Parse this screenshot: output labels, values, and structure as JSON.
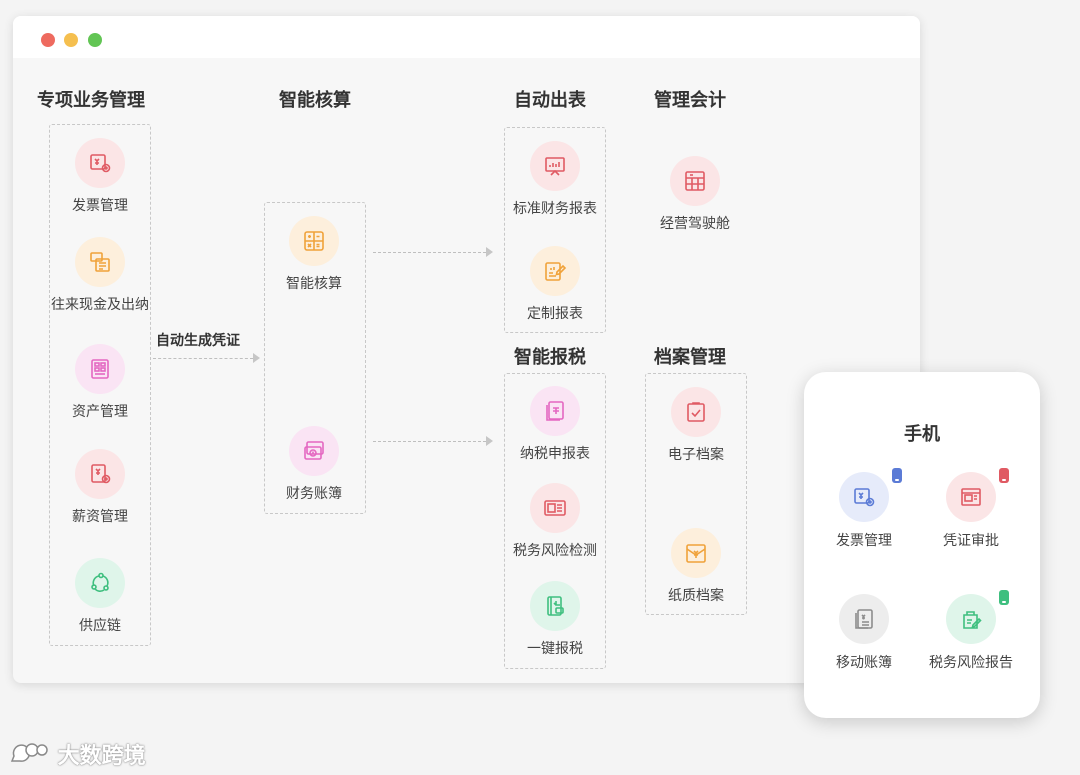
{
  "window": {
    "columns": {
      "special_business": {
        "title": "专项业务管理",
        "items": [
          {
            "label": "发票管理",
            "icon": "invoice-gear-icon"
          },
          {
            "label": "往来现金及出纳",
            "icon": "cash-document-icon"
          },
          {
            "label": "资产管理",
            "icon": "asset-list-icon"
          },
          {
            "label": "薪资管理",
            "icon": "salary-document-icon"
          },
          {
            "label": "供应链",
            "icon": "supply-chain-icon"
          }
        ]
      },
      "arrow_label": "自动生成凭证",
      "smart_accounting": {
        "title": "智能核算",
        "items": [
          {
            "label": "智能核算",
            "icon": "calculator-icon"
          },
          {
            "label": "财务账簿",
            "icon": "money-ledger-icon"
          }
        ]
      },
      "auto_report": {
        "title": "自动出表",
        "items": [
          {
            "label": "标准财务报表",
            "icon": "report-chart-icon"
          },
          {
            "label": "定制报表",
            "icon": "custom-report-icon"
          }
        ]
      },
      "smart_tax": {
        "title": "智能报税",
        "items": [
          {
            "label": "纳税申报表",
            "icon": "tax-form-icon"
          },
          {
            "label": "税务风险检测",
            "icon": "tax-risk-icon"
          },
          {
            "label": "一键报税",
            "icon": "one-click-tax-icon"
          }
        ]
      },
      "management_accounting": {
        "title": "管理会计",
        "items": [
          {
            "label": "经营驾驶舱",
            "icon": "dashboard-table-icon"
          }
        ]
      },
      "archive": {
        "title": "档案管理",
        "items": [
          {
            "label": "电子档案",
            "icon": "electronic-archive-icon"
          },
          {
            "label": "纸质档案",
            "icon": "paper-archive-icon"
          }
        ]
      }
    }
  },
  "phone": {
    "title": "手机",
    "items": [
      {
        "label": "发票管理",
        "icon": "invoice-gear-icon"
      },
      {
        "label": "凭证审批",
        "icon": "voucher-approval-icon"
      },
      {
        "label": "移动账簿",
        "icon": "mobile-ledger-icon"
      },
      {
        "label": "税务风险报告",
        "icon": "tax-risk-report-icon"
      }
    ]
  },
  "watermark": {
    "text": "大数跨境",
    "icon": "speech-bubble-logo-icon"
  },
  "colors": {
    "red": "#e05a63",
    "orange": "#f0a23a",
    "pink": "#e467c1",
    "green": "#3fbf7f",
    "blue": "#5b7bd6",
    "gray": "#8c8c8c"
  }
}
